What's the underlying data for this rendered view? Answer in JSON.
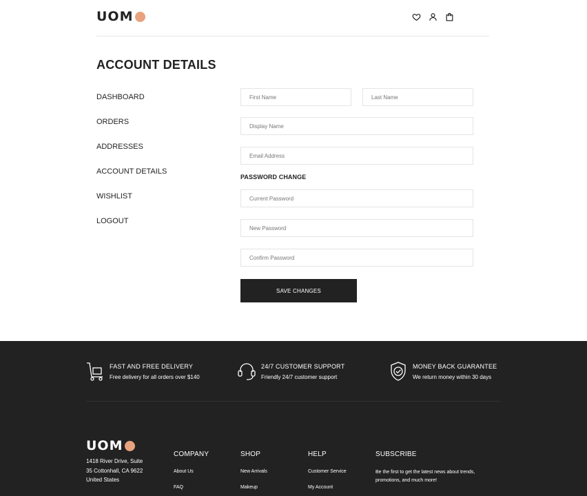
{
  "brand": {
    "logo_text": "UOM",
    "accent_color": "#E8A27E",
    "dark_color": "#222222"
  },
  "header": {
    "icons": [
      "heart-icon",
      "user-icon",
      "shopping-bag-icon"
    ]
  },
  "page": {
    "title": "ACCOUNT DETAILS"
  },
  "sidebar": {
    "items": [
      {
        "label": "DASHBOARD"
      },
      {
        "label": "ORDERS"
      },
      {
        "label": "ADDRESSES"
      },
      {
        "label": "ACCOUNT DETAILS"
      },
      {
        "label": "WISHLIST"
      },
      {
        "label": "LOGOUT"
      }
    ]
  },
  "form": {
    "first_name": {
      "placeholder": "First Name",
      "value": ""
    },
    "last_name": {
      "placeholder": "Last Name",
      "value": ""
    },
    "display_name": {
      "placeholder": "Display Name",
      "value": ""
    },
    "email": {
      "placeholder": "Email Address",
      "value": ""
    },
    "password_section_title": "PASSWORD CHANGE",
    "current_password": {
      "placeholder": "Current Password",
      "value": ""
    },
    "new_password": {
      "placeholder": "New Password",
      "value": ""
    },
    "confirm_password": {
      "placeholder": "Confirm Password",
      "value": ""
    },
    "save_label": "SAVE CHANGES"
  },
  "footer": {
    "features": [
      {
        "icon": "delivery-cart-icon",
        "title": "FAST AND FREE DELIVERY",
        "subtitle": "Free delivery for all orders over $140"
      },
      {
        "icon": "headset-icon",
        "title": "24/7 CUSTOMER SUPPORT",
        "subtitle": "Friendly 24/7 customer support"
      },
      {
        "icon": "shield-check-icon",
        "title": "MONEY BACK GUARANTEE",
        "subtitle": "We return money within 30 days"
      }
    ],
    "logo_text": "UOM",
    "address": [
      "1418 River Drive, Suite",
      "35 Cottonhall, CA 9622",
      "United States"
    ],
    "columns": {
      "company": {
        "title": "COMPANY",
        "links": [
          "About Us",
          "FAQ"
        ]
      },
      "shop": {
        "title": "SHOP",
        "links": [
          "New Arrivals",
          "Makeup"
        ]
      },
      "help": {
        "title": "HELP",
        "links": [
          "Customer Service",
          "My Account"
        ]
      },
      "subscribe": {
        "title": "SUBSCRIBE",
        "text": "Be the first to get the latest news about trends, promotions, and much more!"
      }
    }
  }
}
